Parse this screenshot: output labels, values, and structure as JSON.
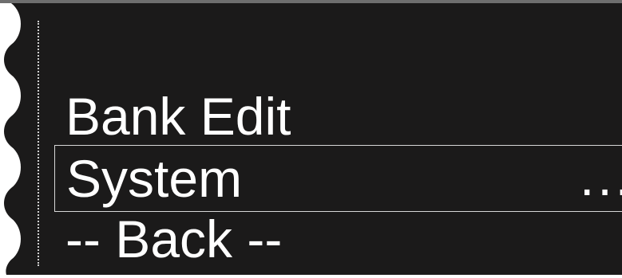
{
  "menu": {
    "items": [
      {
        "label": "Bank Edit",
        "selected": false
      },
      {
        "label": "System",
        "selected": true,
        "submenu_indicator": "..."
      },
      {
        "label": "-- Back --",
        "selected": false
      }
    ]
  },
  "colors": {
    "screen_background": "#1b1a1a",
    "text": "#ffffff",
    "selection_border": "#d7d7d7",
    "top_border": "#6e6e6e"
  }
}
